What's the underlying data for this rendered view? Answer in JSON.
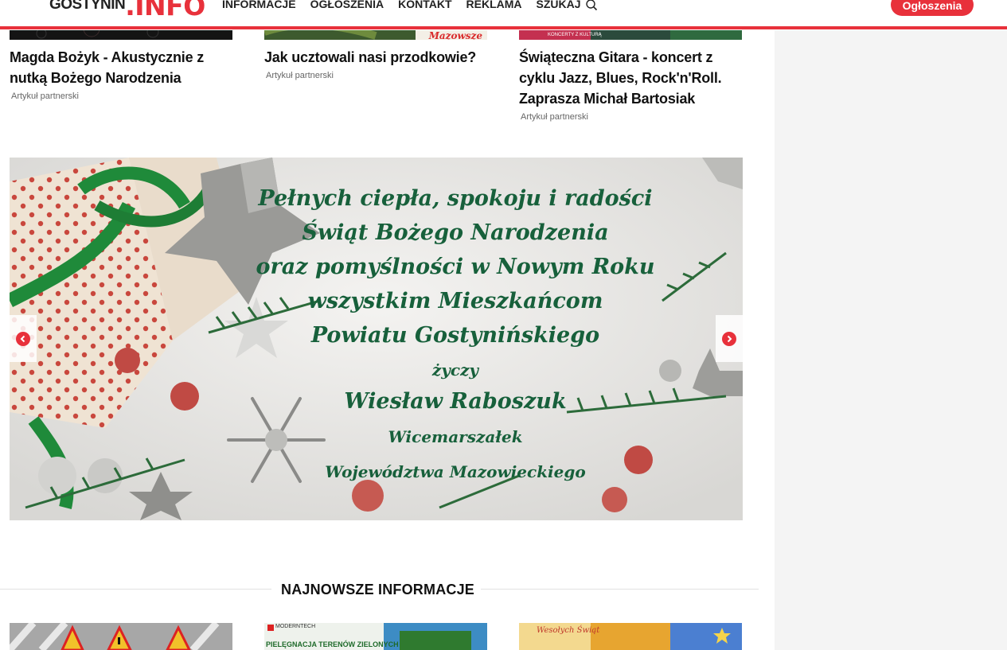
{
  "header": {
    "logo_part1": "GOSTYNIN",
    "logo_part2": ".INFO",
    "nav": [
      "INFORMACJE",
      "OGŁOSZENIA",
      "KONTAKT",
      "REKLAMA",
      "SZUKAJ"
    ],
    "ads_button": "Ogłoszenia",
    "accent_color": "#e8313b"
  },
  "top_cards": [
    {
      "title_lines": [
        "Magda Bożyk - Akustycznie z",
        "nutką Bożego Narodzenia"
      ],
      "label": "Artykuł partnerski"
    },
    {
      "title_lines": [
        "Jak ucztowali nasi przodkowie?"
      ],
      "label": "Artykuł partnerski",
      "thumb_text": "Mazowsze"
    },
    {
      "title_lines": [
        "Świąteczna Gitara - koncert z",
        "cyklu Jazz, Blues, Rock'n'Roll.",
        "Zapraszа Michał Bartosiak"
      ],
      "label": "Artykuł partnerski",
      "thumb_text": "KONCERTY Z KULTURĄ"
    }
  ],
  "banner": {
    "lines": [
      "Pełnych ciepła, spokoju i radości",
      "Świąt Bożego Narodzenia",
      "oraz pomyślności w Nowym Roku",
      "wszystkim Mieszkańcom",
      "Powiatu Gostynińskiego",
      "życzy",
      "Wiesław Raboszuk",
      "Wicemarszałek",
      "Województwa Mazowieckiego"
    ],
    "text_color": "#17603b"
  },
  "section": {
    "title": "NAJNOWSZE INFORMACJE"
  },
  "bottom_thumbs": [
    {
      "text": ""
    },
    {
      "brand": "MODERNTECH",
      "text": "PIELĘGNACJA TERENÓW ZIELONYCH"
    },
    {
      "text": "Wesołych Świąt"
    }
  ]
}
